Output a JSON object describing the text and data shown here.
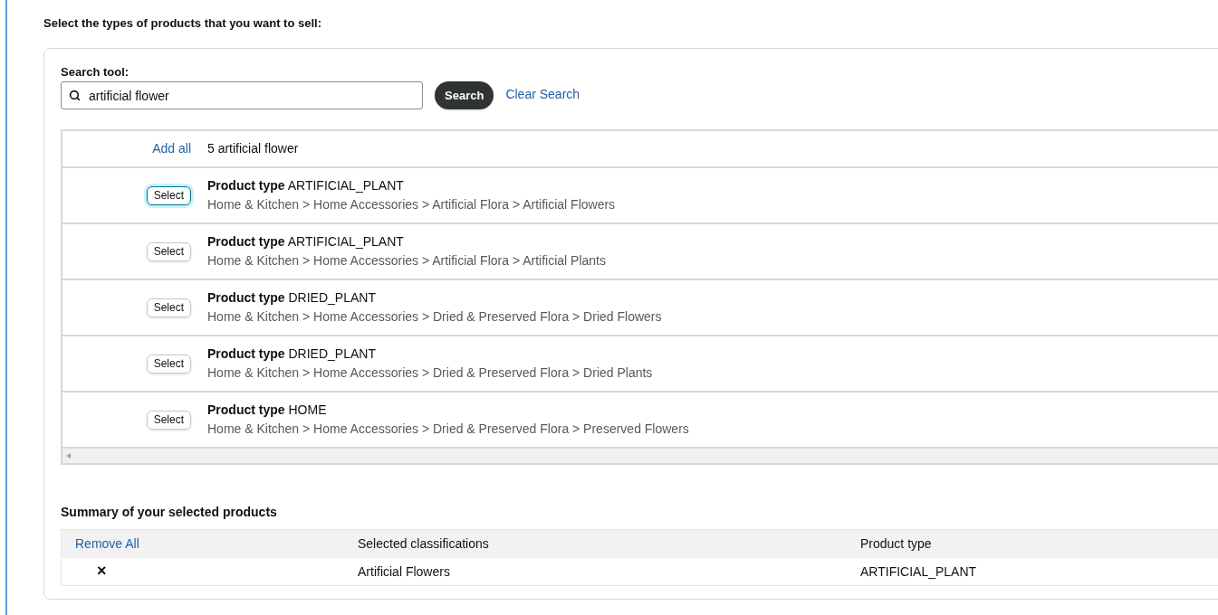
{
  "heading": "Select the types of products that you want to sell:",
  "search": {
    "label": "Search tool:",
    "value": "artificial flower",
    "button": "Search",
    "clear": "Clear Search"
  },
  "results": {
    "add_all": "Add all",
    "count": "5 artificial flower",
    "rows": [
      {
        "button": "Select",
        "selected": true,
        "type_label": "Product type",
        "type": "ARTIFICIAL_PLANT",
        "path": "Home & Kitchen > Home Accessories > Artificial Flora > Artificial Flowers"
      },
      {
        "button": "Select",
        "selected": false,
        "type_label": "Product type",
        "type": "ARTIFICIAL_PLANT",
        "path": "Home & Kitchen > Home Accessories > Artificial Flora > Artificial Plants"
      },
      {
        "button": "Select",
        "selected": false,
        "type_label": "Product type",
        "type": "DRIED_PLANT",
        "path": "Home & Kitchen > Home Accessories > Dried & Preserved Flora > Dried Flowers"
      },
      {
        "button": "Select",
        "selected": false,
        "type_label": "Product type",
        "type": "DRIED_PLANT",
        "path": "Home & Kitchen > Home Accessories > Dried & Preserved Flora > Dried Plants"
      },
      {
        "button": "Select",
        "selected": false,
        "type_label": "Product type",
        "type": "HOME",
        "path": "Home & Kitchen > Home Accessories > Dried & Preserved Flora > Preserved Flowers"
      }
    ]
  },
  "summary": {
    "title": "Summary of your selected products",
    "remove_all": "Remove All",
    "columns": [
      "Selected classifications",
      "Product type"
    ],
    "rows": [
      {
        "remove": "×",
        "classification": "Artificial Flowers",
        "type": "ARTIFICIAL_PLANT"
      }
    ]
  }
}
